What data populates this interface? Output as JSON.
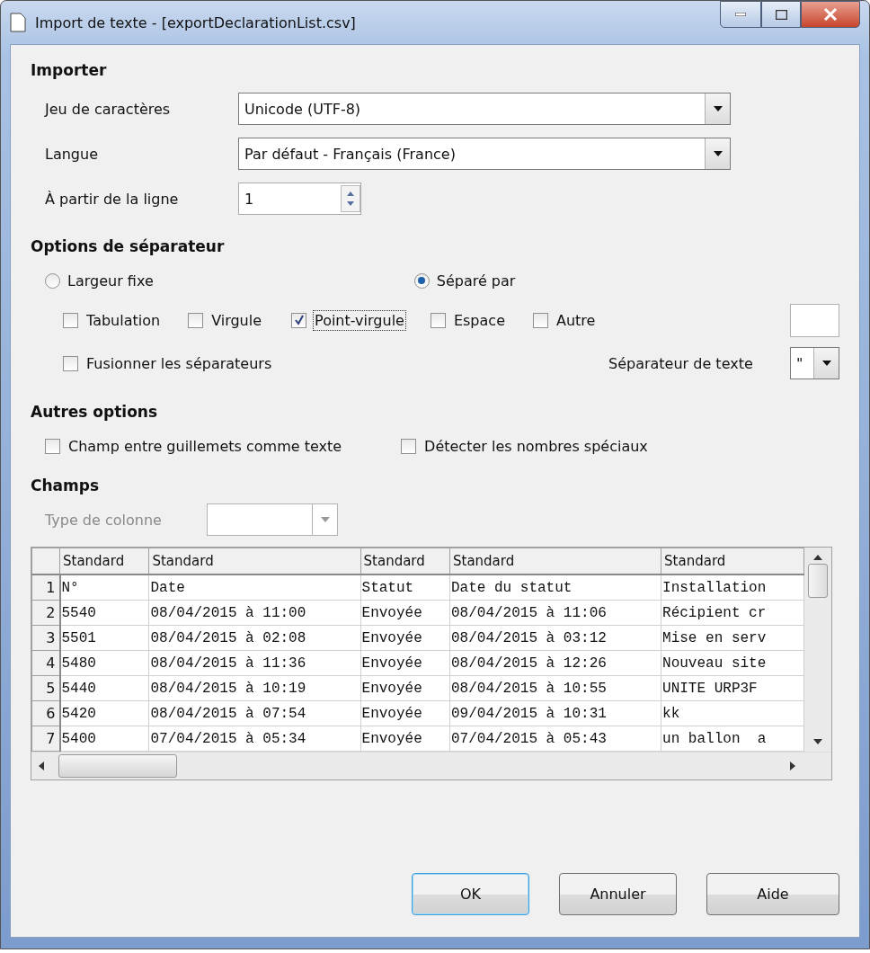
{
  "window": {
    "title": "Import de texte - [exportDeclarationList.csv]"
  },
  "importer": {
    "heading": "Importer",
    "fields": [
      {
        "kind": "combo",
        "label": "Jeu de caractères",
        "value": "Unicode (UTF-8)"
      },
      {
        "kind": "combo",
        "label": "Langue",
        "value": "Par défaut - Français (France)"
      },
      {
        "kind": "spin",
        "label": "À partir de la ligne",
        "value": "1"
      }
    ]
  },
  "separator_options": {
    "heading": "Options de séparateur",
    "modes": [
      {
        "label": "Largeur fixe",
        "selected": false
      },
      {
        "label": "Séparé par",
        "selected": true
      }
    ],
    "separators": [
      {
        "label": "Tabulation",
        "checked": false,
        "focused": false
      },
      {
        "label": "Virgule",
        "checked": false,
        "focused": false
      },
      {
        "label": "Point-virgule",
        "checked": true,
        "focused": true
      },
      {
        "label": "Espace",
        "checked": false,
        "focused": false
      },
      {
        "label": "Autre",
        "checked": false,
        "focused": false
      }
    ],
    "merge": {
      "label": "Fusionner les séparateurs",
      "checked": false
    },
    "text_separator": {
      "label": "Séparateur de texte",
      "value": "\""
    }
  },
  "other_options": {
    "heading": "Autres options",
    "options": [
      {
        "label": "Champ entre guillemets comme texte",
        "checked": false
      },
      {
        "label": "Détecter les nombres spéciaux",
        "checked": false
      }
    ]
  },
  "fields": {
    "heading": "Champs",
    "column_type": {
      "label": "Type de colonne",
      "disabled": true
    },
    "table": {
      "columns": [
        "Standard",
        "Standard",
        "Standard",
        "Standard",
        "Standard"
      ],
      "rows": [
        {
          "number": "1",
          "cells": [
            "N°",
            "Date",
            "Statut",
            "Date du statut",
            "Installation"
          ]
        },
        {
          "number": "2",
          "cells": [
            "5540",
            "08/04/2015 à 11:00",
            "Envoyée",
            "08/04/2015 à 11:06",
            "Récipient cr"
          ]
        },
        {
          "number": "3",
          "cells": [
            "5501",
            "08/04/2015 à 02:08",
            "Envoyée",
            "08/04/2015 à 03:12",
            "Mise en serv"
          ]
        },
        {
          "number": "4",
          "cells": [
            "5480",
            "08/04/2015 à 11:36",
            "Envoyée",
            "08/04/2015 à 12:26",
            "Nouveau site"
          ]
        },
        {
          "number": "5",
          "cells": [
            "5440",
            "08/04/2015 à 10:19",
            "Envoyée",
            "08/04/2015 à 10:55",
            "UNITE URP3F"
          ]
        },
        {
          "number": "6",
          "cells": [
            "5420",
            "08/04/2015 à 07:54",
            "Envoyée",
            "09/04/2015 à 10:31",
            "kk"
          ]
        },
        {
          "number": "7",
          "cells": [
            "5400",
            "07/04/2015 à 05:34",
            "Envoyée",
            "07/04/2015 à 05:43",
            "un ballon  a"
          ]
        }
      ]
    }
  },
  "buttons": [
    {
      "label": "OK",
      "default": true
    },
    {
      "label": "Annuler",
      "default": false
    },
    {
      "label": "Aide",
      "default": false
    }
  ]
}
